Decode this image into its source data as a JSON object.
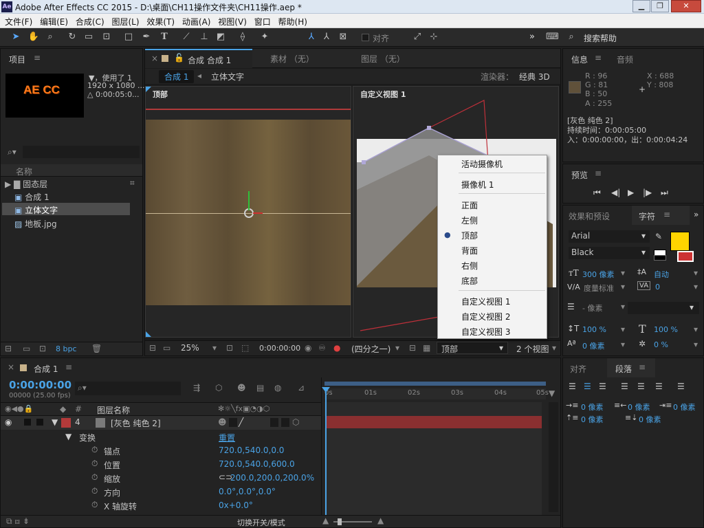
{
  "window": {
    "title": "Adobe After Effects CC 2015 - D:\\桌面\\CH11操作文件夹\\CH11操作.aep *",
    "logo": "Ae"
  },
  "menu": [
    "文件(F)",
    "编辑(E)",
    "合成(C)",
    "图层(L)",
    "效果(T)",
    "动画(A)",
    "视图(V)",
    "窗口",
    "帮助(H)"
  ],
  "toolbar": {
    "align_label": "对齐",
    "search_label": "搜索帮助"
  },
  "project": {
    "tab": "项目",
    "thumb_text": "AE CC",
    "info_line1": "▼，使用了 1",
    "info_line2": "1920 x 1080 ...",
    "info_line3": "△ 0:00:05:0...",
    "search_placeholder": "",
    "col_name": "名称",
    "items": [
      "固态层",
      "合成 1",
      "立体文字",
      "地板.jpg"
    ],
    "bpc": "8 bpc"
  },
  "viewer": {
    "tabs": [
      "合成 合成 1",
      "素材 （无）",
      "图层 （无）"
    ],
    "breadcrumb": [
      "合成 1",
      "立体文字"
    ],
    "renderer_label": "渲染器：",
    "renderer_value": "经典 3D",
    "left_view_label": "顶部",
    "right_view_label": "自定义视图 1",
    "zoom": "25%",
    "timecode": "0:00:00:00",
    "resolution": "(四分之一)",
    "view_select": "顶部",
    "views_count": "2 个视图"
  },
  "view_menu": {
    "items": [
      "活动摄像机",
      "摄像机 1",
      "正面",
      "左侧",
      "顶部",
      "背面",
      "右侧",
      "底部",
      "自定义视图 1",
      "自定义视图 2",
      "自定义视图 3"
    ],
    "selected": "顶部"
  },
  "info": {
    "tabs": [
      "信息",
      "音频"
    ],
    "r": "R : 96",
    "g": "G : 81",
    "b": "B : 50",
    "a": "A : 255",
    "x": "X : 688",
    "y": "Y : 808",
    "layer": "[灰色 纯色 2]",
    "duration": "持续时间：0:00:05:00",
    "inout": "入：0:00:00:00，出：0:00:04:24",
    "swatch_color": "#60513a"
  },
  "preview": {
    "tab": "预览"
  },
  "character": {
    "tabs": [
      "效果和预设",
      "字符"
    ],
    "font": "Arial",
    "style": "Black",
    "size": "300 像素",
    "leading": "自动",
    "kerning": "度量标准",
    "tracking": "0",
    "stroke": "- 像素",
    "vscale": "100 %",
    "hscale": "100 %",
    "baseline": "0 像素",
    "tsume": "0 %",
    "fill_color": "#ffd400"
  },
  "paragraph": {
    "tabs": [
      "对齐",
      "段落"
    ],
    "indent_left": "0 像素",
    "indent_right": "0 像素",
    "indent_first": "0 像素",
    "space_before": "0 像素",
    "space_after": "0 像素"
  },
  "timeline": {
    "tab": "合成 1",
    "timecode": "0:00:00:00",
    "fps": "00000 (25.00 fps)",
    "col_num": "#",
    "col_name": "图层名称",
    "layer_index": "4",
    "layer_name": "[灰色 纯色 2]",
    "transform": "变换",
    "reset": "重置",
    "props": [
      {
        "name": "锚点",
        "value": "720.0,540.0,0.0"
      },
      {
        "name": "位置",
        "value": "720.0,540.0,600.0"
      },
      {
        "name": "缩放",
        "value": "200.0,200.0,200.0%"
      },
      {
        "name": "方向",
        "value": "0.0°,0.0°,0.0°"
      },
      {
        "name": "X 轴旋转",
        "value": "0x+0.0°"
      }
    ],
    "ruler": [
      "0s",
      "01s",
      "02s",
      "03s",
      "04s",
      "05s"
    ],
    "toggle_label": "切换开关/模式"
  }
}
